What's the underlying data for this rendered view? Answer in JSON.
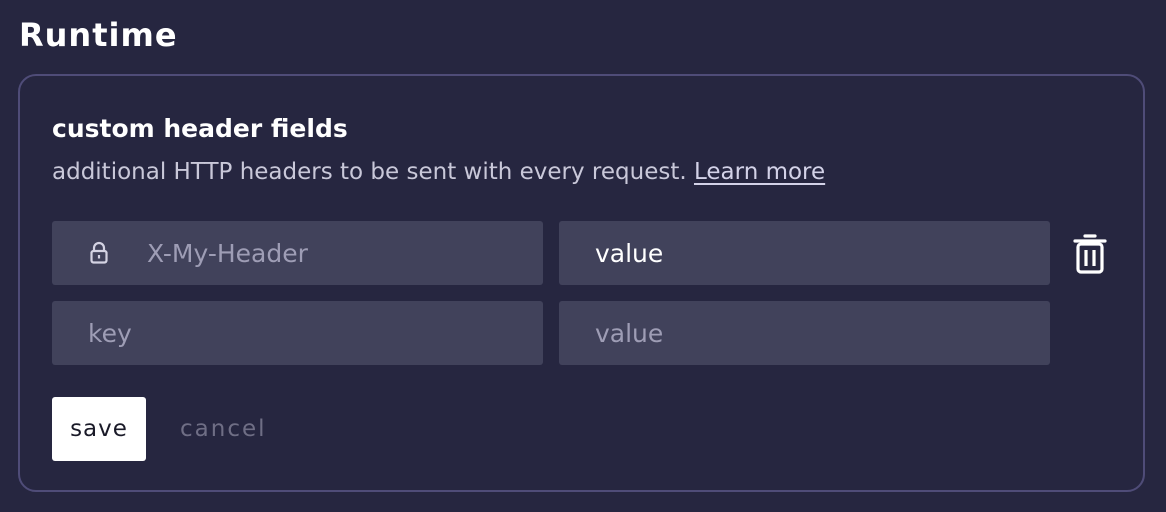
{
  "section": {
    "title": "Runtime"
  },
  "panel": {
    "title": "custom header fields",
    "description": "additional HTTP headers to be sent with every request.",
    "learn_more": "Learn more"
  },
  "headers": [
    {
      "key_value": "",
      "key_placeholder": "X-My-Header",
      "value_value": "value",
      "value_placeholder": "",
      "locked": true,
      "lock_icon": "lock-icon",
      "delete_icon": "trash-icon"
    },
    {
      "key_value": "",
      "key_placeholder": "key",
      "value_value": "",
      "value_placeholder": "value"
    }
  ],
  "actions": {
    "save_label": "save",
    "cancel_label": "cancel"
  },
  "colors": {
    "background": "#262640",
    "panel_border": "#4f4c78",
    "field_background": "#41425b",
    "placeholder_text": "#9e9db5",
    "save_background": "#ffffff",
    "cancel_text": "#6f6e85"
  }
}
